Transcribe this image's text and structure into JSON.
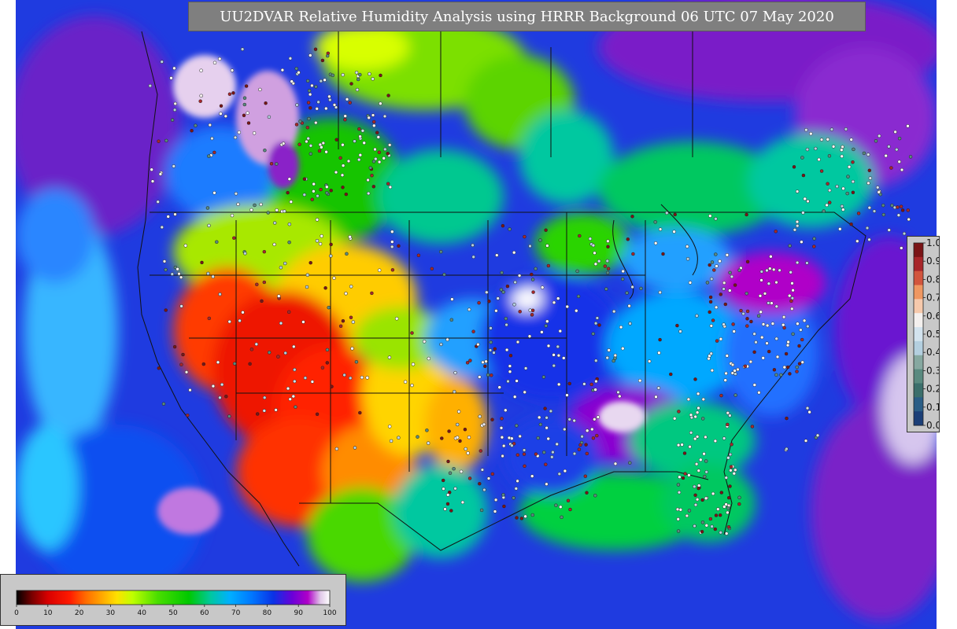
{
  "title": "UU2DVAR Relative Humidity Analysis using HRRR Background 06 UTC 07 May 2020",
  "obs_legend": {
    "ticks": [
      "1.0",
      "0.9",
      "0.8",
      "0.7",
      "0.6",
      "0.5",
      "0.4",
      "0.3",
      "0.2",
      "0.1",
      "0.0"
    ],
    "colors": [
      "#7a1416",
      "#a8262a",
      "#d2553d",
      "#ef9762",
      "#f6c9ac",
      "#f4f0ee",
      "#d3e3ee",
      "#b4cfdf",
      "#86a8a0",
      "#598a7f",
      "#3b6f6b",
      "#2a5e86",
      "#1b3f77"
    ]
  },
  "rh_colorbar": {
    "ticks": [
      "0",
      "10",
      "20",
      "30",
      "40",
      "50",
      "60",
      "70",
      "80",
      "90",
      "100"
    ],
    "stops": [
      {
        "v": 0,
        "c": "#000000"
      },
      {
        "v": 5,
        "c": "#7a0000"
      },
      {
        "v": 10,
        "c": "#d80000"
      },
      {
        "v": 17,
        "c": "#ff1a00"
      },
      {
        "v": 22,
        "c": "#ff6a00"
      },
      {
        "v": 27,
        "c": "#ffa500"
      },
      {
        "v": 32,
        "c": "#ffe000"
      },
      {
        "v": 37,
        "c": "#c0ff00"
      },
      {
        "v": 45,
        "c": "#4ade00"
      },
      {
        "v": 55,
        "c": "#00c800"
      },
      {
        "v": 62,
        "c": "#00c8a0"
      },
      {
        "v": 68,
        "c": "#00b0ff"
      },
      {
        "v": 75,
        "c": "#0078ff"
      },
      {
        "v": 82,
        "c": "#0a32e6"
      },
      {
        "v": 88,
        "c": "#6a00d8"
      },
      {
        "v": 93,
        "c": "#b000c8"
      },
      {
        "v": 97,
        "c": "#e0c8e8"
      },
      {
        "v": 100,
        "c": "#ffffff"
      }
    ]
  }
}
